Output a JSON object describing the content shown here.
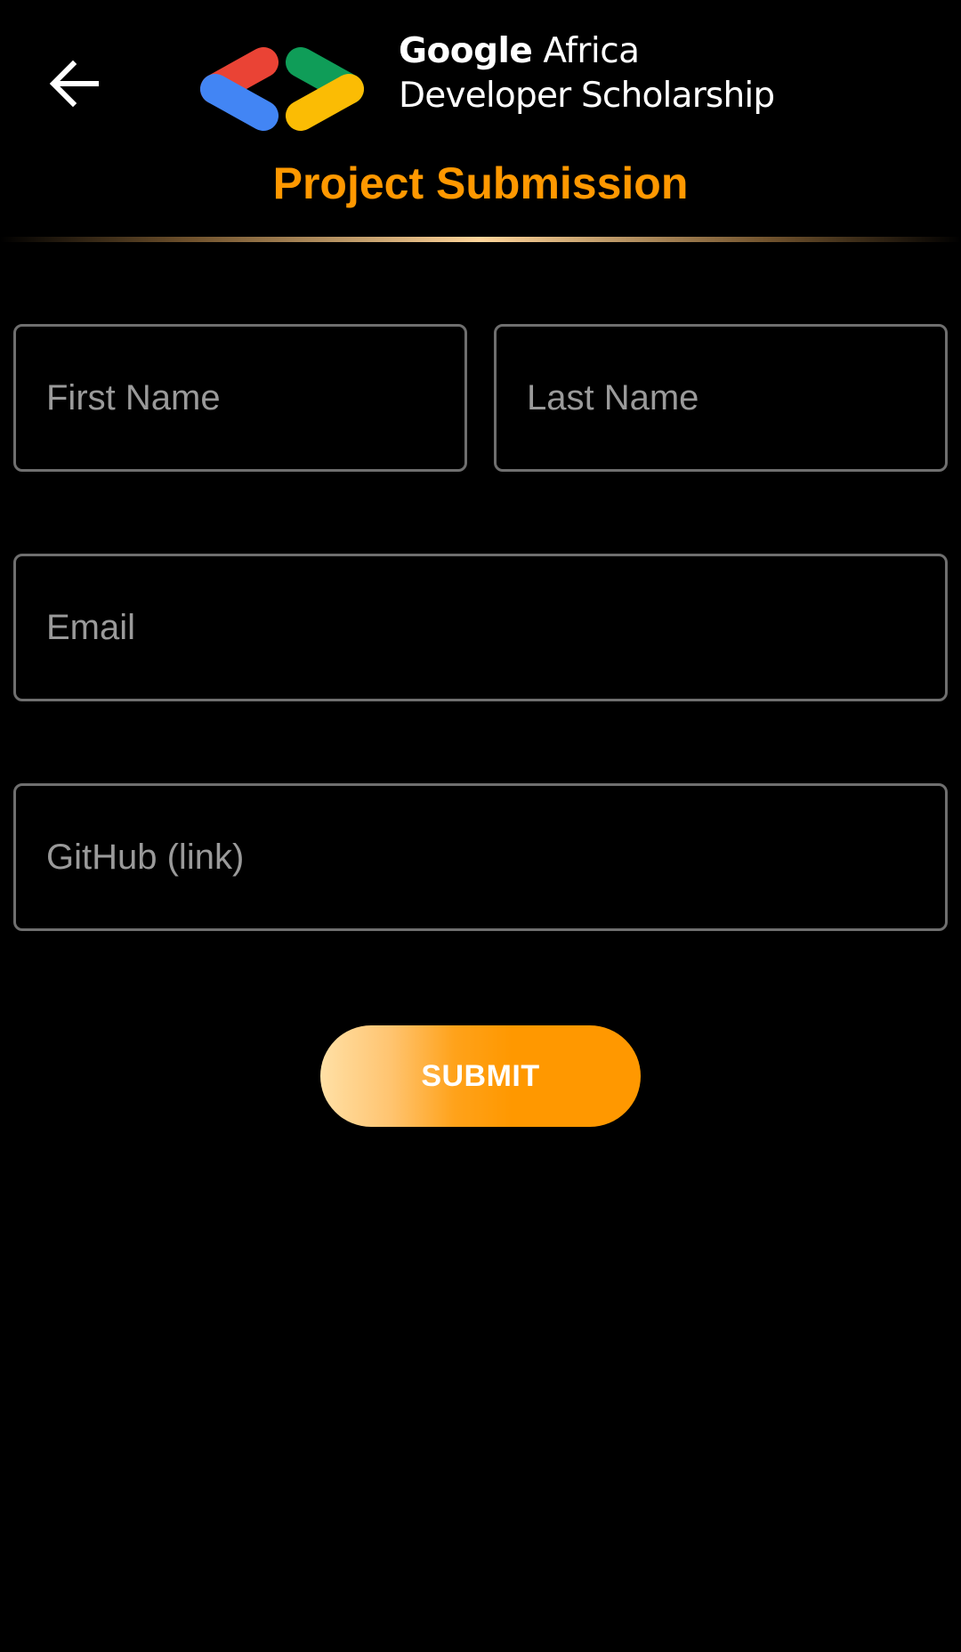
{
  "header": {
    "back_icon": "arrow-left-icon",
    "logo": {
      "brand": "Google",
      "line1_rest": "Africa",
      "line2": "Developer Scholarship",
      "mark_colors": {
        "red": "#EA4335",
        "blue": "#4285F4",
        "green": "#0F9D58",
        "yellow": "#FBBC04"
      }
    },
    "title": "Project Submission",
    "title_color": "#FF9800"
  },
  "form": {
    "first_name": {
      "placeholder": "First Name",
      "value": ""
    },
    "last_name": {
      "placeholder": "Last Name",
      "value": ""
    },
    "email": {
      "placeholder": "Email",
      "value": ""
    },
    "github": {
      "placeholder": "GitHub (link)",
      "value": ""
    },
    "submit_label": "SUBMIT"
  },
  "colors": {
    "background": "#000000",
    "accent": "#FF9800",
    "field_border": "#6F6F6F",
    "placeholder": "#9A9A9A"
  }
}
